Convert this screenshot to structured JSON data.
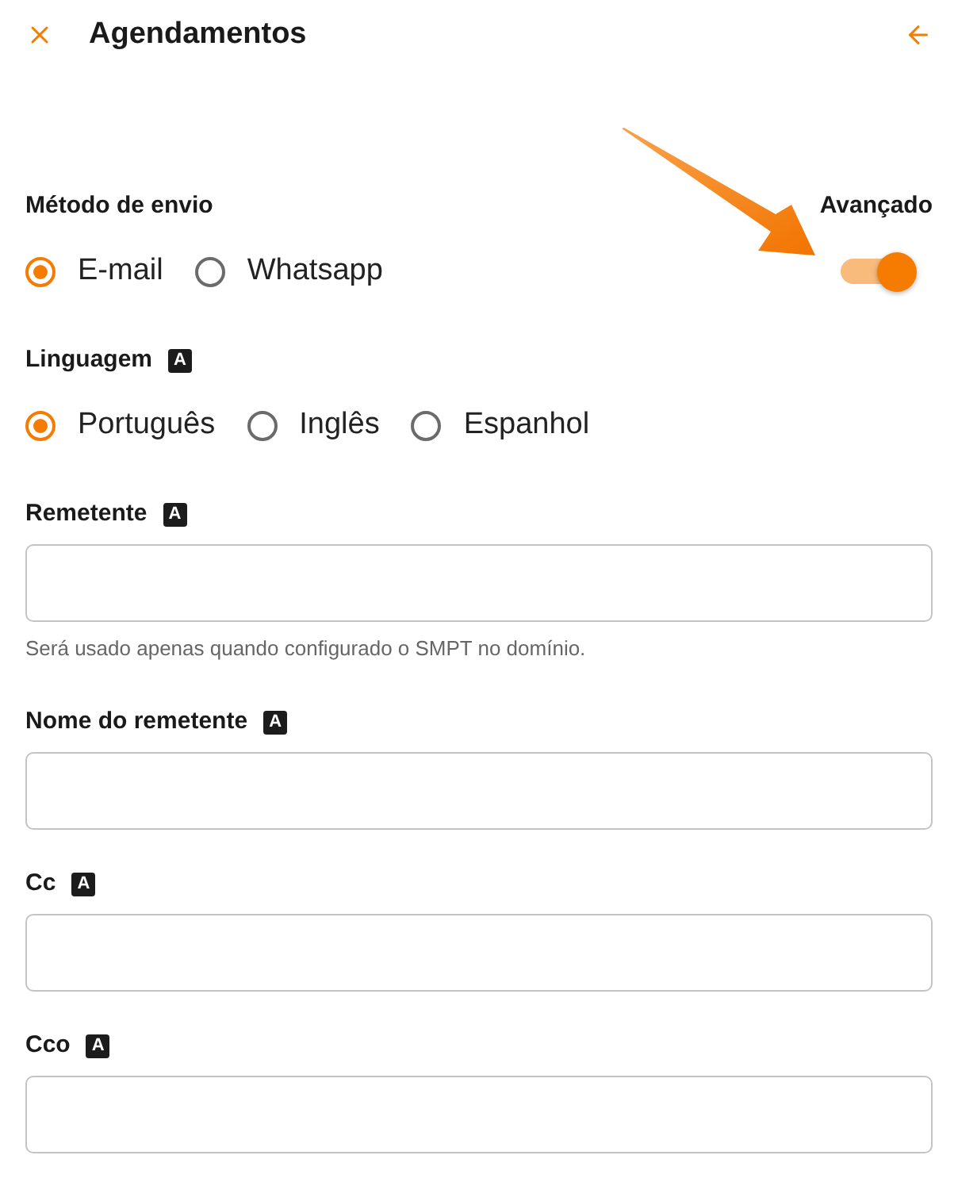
{
  "header": {
    "title": "Agendamentos"
  },
  "send_method": {
    "label": "Método de envio",
    "options": [
      {
        "label": "E-mail",
        "selected": true
      },
      {
        "label": "Whatsapp",
        "selected": false
      }
    ]
  },
  "advanced": {
    "label": "Avançado",
    "on": true
  },
  "annotation": {
    "kind": "arrow"
  },
  "language": {
    "label": "Linguagem",
    "badge": "A",
    "options": [
      {
        "label": "Português",
        "selected": true
      },
      {
        "label": "Inglês",
        "selected": false
      },
      {
        "label": "Espanhol",
        "selected": false
      }
    ]
  },
  "fields": [
    {
      "label": "Remetente",
      "badge": "A",
      "help": "Será usado apenas quando configurado o SMPT no domínio."
    },
    {
      "label": "Nome do remetente",
      "badge": "A"
    },
    {
      "label": "Cc",
      "badge": "A"
    },
    {
      "label": "Cco",
      "badge": "A"
    }
  ]
}
